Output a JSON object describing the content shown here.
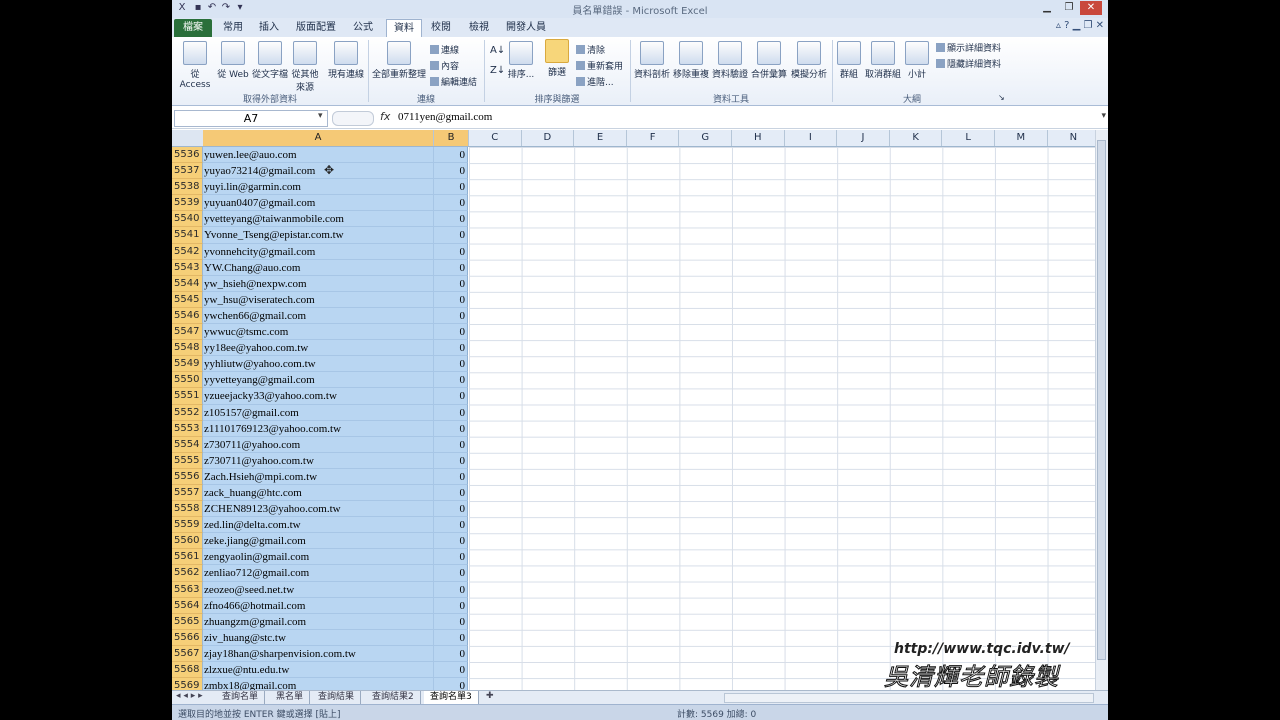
{
  "window": {
    "title": "員名單錯誤 - Microsoft Excel"
  },
  "tabs": [
    "檔案",
    "常用",
    "插入",
    "版面配置",
    "公式",
    "資料",
    "校閱",
    "檢視",
    "開發人員"
  ],
  "ribbon": {
    "get_external": {
      "buttons": [
        "從 Access",
        "從 Web",
        "從文字檔",
        "從其他來源",
        "現有連線"
      ],
      "group_label": "取得外部資料"
    },
    "connections": {
      "refresh_all": "全部重新整理",
      "items": [
        "連線",
        "內容",
        "編輯連結"
      ],
      "group_label": "連線"
    },
    "sort_filter": {
      "sort": "排序...",
      "filter": "篩選",
      "items": [
        "清除",
        "重新套用",
        "進階..."
      ],
      "group_label": "排序與篩選"
    },
    "data_tools": {
      "buttons": [
        "資料剖析",
        "移除重複",
        "資料驗證",
        "合併彙算",
        "模擬分析"
      ],
      "group_label": "資料工具"
    },
    "outline": {
      "buttons": [
        "群組",
        "取消群組",
        "小計"
      ],
      "items": [
        "顯示詳細資料",
        "隱藏詳細資料"
      ],
      "group_label": "大綱"
    }
  },
  "formula_bar": {
    "name_box": "A7",
    "fx": "fx",
    "value": "0711yen@gmail.com"
  },
  "columns": [
    "A",
    "B",
    "C",
    "D",
    "E",
    "F",
    "G",
    "H",
    "I",
    "J",
    "K",
    "L",
    "M",
    "N"
  ],
  "rows": [
    {
      "num": "5536",
      "a": "yuwen.lee@auo.com",
      "b": "0"
    },
    {
      "num": "5537",
      "a": "yuyao73214@gmail.com",
      "b": "0"
    },
    {
      "num": "5538",
      "a": "yuyi.lin@garmin.com",
      "b": "0"
    },
    {
      "num": "5539",
      "a": "yuyuan0407@gmail.com",
      "b": "0"
    },
    {
      "num": "5540",
      "a": "yvetteyang@taiwanmobile.com",
      "b": "0"
    },
    {
      "num": "5541",
      "a": "Yvonne_Tseng@epistar.com.tw",
      "b": "0"
    },
    {
      "num": "5542",
      "a": "yvonnehcity@gmail.com",
      "b": "0"
    },
    {
      "num": "5543",
      "a": "YW.Chang@auo.com",
      "b": "0"
    },
    {
      "num": "5544",
      "a": "yw_hsieh@nexpw.com",
      "b": "0"
    },
    {
      "num": "5545",
      "a": "yw_hsu@viseratech.com",
      "b": "0"
    },
    {
      "num": "5546",
      "a": "ywchen66@gmail.com",
      "b": "0"
    },
    {
      "num": "5547",
      "a": "ywwuc@tsmc.com",
      "b": "0"
    },
    {
      "num": "5548",
      "a": "yy18ee@yahoo.com.tw",
      "b": "0"
    },
    {
      "num": "5549",
      "a": "yyhliutw@yahoo.com.tw",
      "b": "0"
    },
    {
      "num": "5550",
      "a": "yyvetteyang@gmail.com",
      "b": "0"
    },
    {
      "num": "5551",
      "a": "yzueejacky33@yahoo.com.tw",
      "b": "0"
    },
    {
      "num": "5552",
      "a": "z105157@gmail.com",
      "b": "0"
    },
    {
      "num": "5553",
      "a": "z11101769123@yahoo.com.tw",
      "b": "0"
    },
    {
      "num": "5554",
      "a": "z730711@yahoo.com",
      "b": "0"
    },
    {
      "num": "5555",
      "a": "z730711@yahoo.com.tw",
      "b": "0"
    },
    {
      "num": "5556",
      "a": "Zach.Hsieh@mpi.com.tw",
      "b": "0"
    },
    {
      "num": "5557",
      "a": "zack_huang@htc.com",
      "b": "0"
    },
    {
      "num": "5558",
      "a": "ZCHEN89123@yahoo.com.tw",
      "b": "0"
    },
    {
      "num": "5559",
      "a": "zed.lin@delta.com.tw",
      "b": "0"
    },
    {
      "num": "5560",
      "a": "zeke.jiang@gmail.com",
      "b": "0"
    },
    {
      "num": "5561",
      "a": "zengyaolin@gmail.com",
      "b": "0"
    },
    {
      "num": "5562",
      "a": "zenliao712@gmail.com",
      "b": "0"
    },
    {
      "num": "5563",
      "a": "zeozeo@seed.net.tw",
      "b": "0"
    },
    {
      "num": "5564",
      "a": "zfno466@hotmail.com",
      "b": "0"
    },
    {
      "num": "5565",
      "a": "zhuangzm@gmail.com",
      "b": "0"
    },
    {
      "num": "5566",
      "a": "ziv_huang@stc.tw",
      "b": "0"
    },
    {
      "num": "5567",
      "a": "zjay18han@sharpenvision.com.tw",
      "b": "0"
    },
    {
      "num": "5568",
      "a": "zlzxue@ntu.edu.tw",
      "b": "0"
    },
    {
      "num": "5569",
      "a": "zmbx18@gmail.com",
      "b": "0"
    }
  ],
  "sheet_tabs": [
    "查詢名單",
    "黑名單",
    "查詢結果",
    "查詢結果2",
    "查詢名單3"
  ],
  "active_sheet": "查詢名單3",
  "status": {
    "left": "選取目的地並按 ENTER 鍵或選擇 [貼上]",
    "right": "計數: 5569  加總: 0"
  },
  "watermark": {
    "url": "http://www.tqc.idv.tw/",
    "name": "吳清輝老師錄製"
  },
  "colors": {
    "selection": "#b9d6f2",
    "header_highlight": "#f6cf78",
    "file_tab": "#2a6f3a"
  }
}
